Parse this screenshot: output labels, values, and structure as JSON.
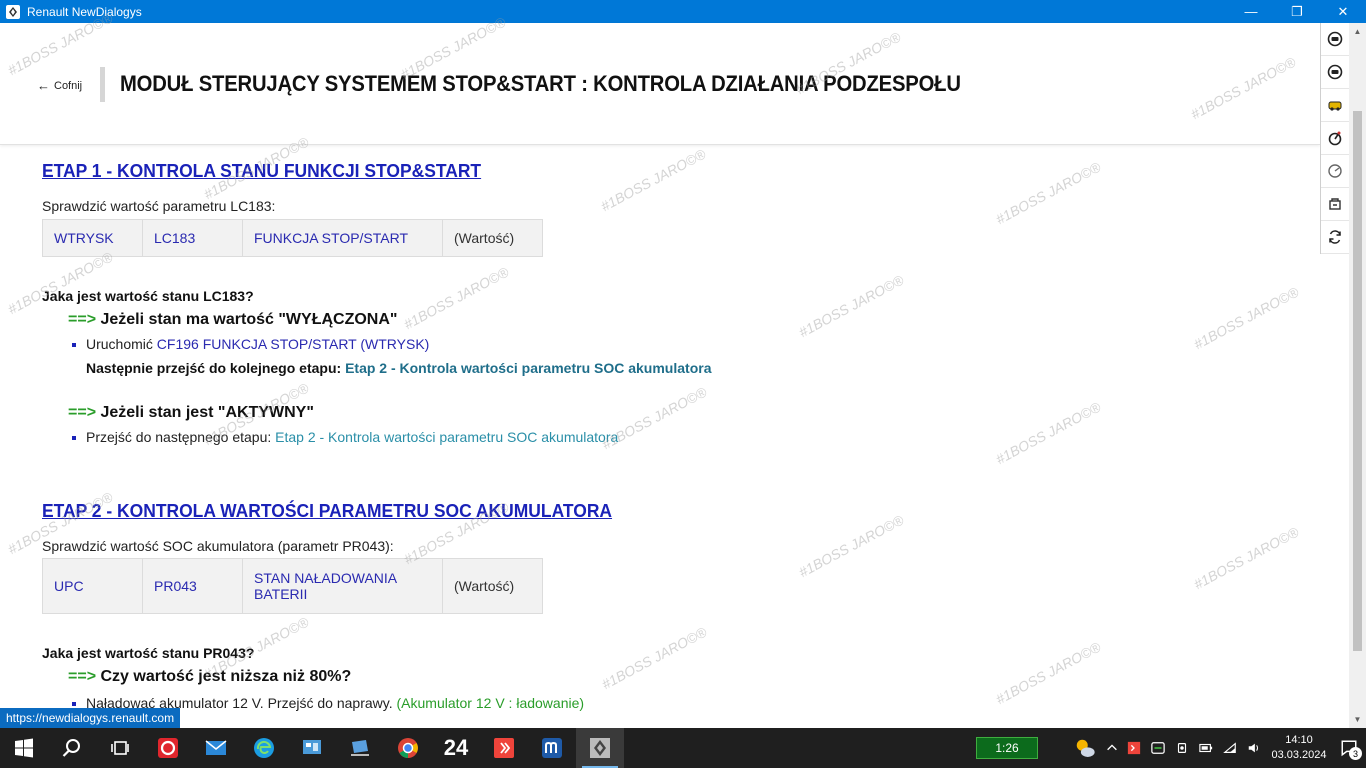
{
  "window": {
    "title": "Renault NewDialogys",
    "minimize": "—",
    "maximize": "❐",
    "close": "✕"
  },
  "header": {
    "back_label": "Cofnij",
    "title": "MODUŁ STERUJĄCY SYSTEMEM STOP&START : KONTROLA DZIAŁANIA PODZESPOŁU"
  },
  "watermark": "#1BOSS JARO©®",
  "stage1": {
    "title": "ETAP 1 - KONTROLA STANU FUNKCJI STOP&START",
    "check_text": "Sprawdzić wartość parametru LC183:",
    "table": [
      "WTRYSK",
      "LC183",
      "FUNKCJA STOP/START",
      "(Wartość)"
    ],
    "question": "Jaka jest wartość stanu LC183?",
    "cond1_arrow": "==>",
    "cond1_text": "Jeżeli stan ma wartość \"WYŁĄCZONA\"",
    "cond1_bullet_prefix": "Uruchomić",
    "cond1_bullet_link": "CF196 FUNKCJA STOP/START (WTRYSK)",
    "cond1_next_label": "Następnie przejść do kolejnego etapu:",
    "cond1_next_link": "Etap 2 - Kontrola wartości parametru SOC akumulatora",
    "cond2_arrow": "==>",
    "cond2_text": "Jeżeli stan jest \"AKTYWNY\"",
    "cond2_bullet_prefix": "Przejść do następnego etapu:",
    "cond2_bullet_link": "Etap 2 - Kontrola wartości parametru SOC akumulatora"
  },
  "stage2": {
    "title": "ETAP 2 - KONTROLA WARTOŚCI PARAMETRU SOC AKUMULATORA",
    "check_text": "Sprawdzić wartość SOC akumulatora (parametr PR043):",
    "table": [
      "UPC",
      "PR043",
      "STAN NAŁADOWANIA BATERII",
      "(Wartość)"
    ],
    "question": "Jaka jest wartość stanu PR043?",
    "cond1_arrow": "==>",
    "cond1_text": "Czy wartość jest niższa niż 80%?",
    "cond1_bullet_prefix": "Naładować akumulator 12 V. Przejść do naprawy.",
    "cond1_bullet_link": "(Akumulator 12 V : ładowanie)"
  },
  "status_url": "https://newdialogys.renault.com",
  "taskbar": {
    "battery_widget": "1:26",
    "clock_time": "14:10",
    "clock_date": "03.03.2024",
    "notification_count": "3",
    "app_24_label": "24"
  },
  "colors": {
    "titlebar": "#0078d7",
    "stage_title": "#1a22b8",
    "arrow_green": "#2a9d2a",
    "teal_link": "#2a8fa8"
  }
}
